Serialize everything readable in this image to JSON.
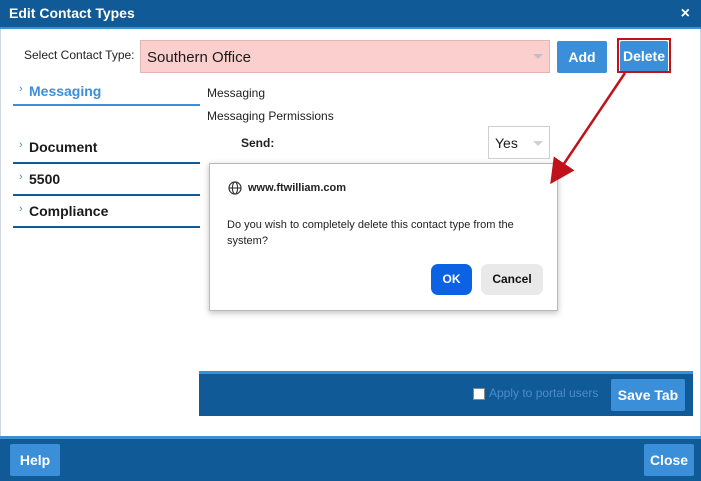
{
  "window": {
    "title": "Edit Contact Types",
    "close_glyph": "×"
  },
  "contact_type": {
    "label": "Select Contact Type:",
    "selected": "Southern Office"
  },
  "buttons": {
    "add": "Add",
    "delete": "Delete",
    "save_tab": "Save Tab",
    "help": "Help",
    "close": "Close"
  },
  "nav": {
    "items": [
      {
        "label": "Messaging",
        "active": true
      },
      {
        "label": "Document"
      },
      {
        "label": "5500"
      },
      {
        "label": "Compliance"
      }
    ]
  },
  "messaging": {
    "heading": "Messaging",
    "permissions": "Messaging Permissions",
    "send_label": "Send:",
    "send_value": "Yes"
  },
  "dialog": {
    "origin": "www.ftwilliam.com",
    "message": "Do you wish to completely delete this contact type from the system?",
    "ok": "OK",
    "cancel": "Cancel"
  },
  "portal": {
    "label": "Apply to portal users"
  },
  "colors": {
    "primary": "#0f5a97",
    "accent": "#3b8fd9",
    "highlight": "#c0121b",
    "select_bg": "#fccfcf"
  }
}
